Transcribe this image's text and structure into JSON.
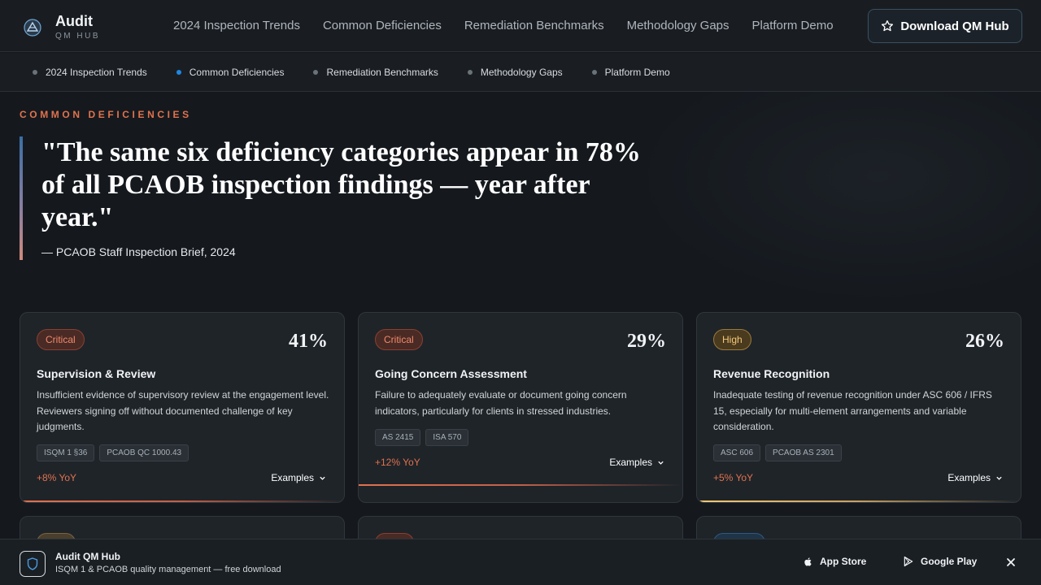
{
  "brand": {
    "name": "Audit",
    "sub": "QM HUB"
  },
  "topnav": [
    "2024 Inspection Trends",
    "Common Deficiencies",
    "Remediation Benchmarks",
    "Methodology Gaps",
    "Platform Demo"
  ],
  "download_label": "Download QM Hub",
  "subnav": {
    "active_index": 1,
    "items": [
      "2024 Inspection Trends",
      "Common Deficiencies",
      "Remediation Benchmarks",
      "Methodology Gaps",
      "Platform Demo"
    ]
  },
  "hero": {
    "eyebrow": "COMMON DEFICIENCIES",
    "quote": "\"The same six deficiency categories appear in 78% of all PCAOB inspection findings — year after year.\"",
    "source": "— PCAOB Staff Inspection Brief, 2024"
  },
  "cards": [
    {
      "severity": "Critical",
      "percent": "41%",
      "title": "Supervision & Review",
      "description": "Insufficient evidence of supervisory review at the engagement level. Reviewers signing off without documented challenge of key judgments.",
      "tags": [
        "ISQM 1 §36",
        "PCAOB QC 1000.43"
      ],
      "yoy": "+8% YoY",
      "examples": "Examples"
    },
    {
      "severity": "Critical",
      "percent": "29%",
      "title": "Going Concern Assessment",
      "description": "Failure to adequately evaluate or document going concern indicators, particularly for clients in stressed industries.",
      "tags": [
        "AS 2415",
        "ISA 570"
      ],
      "yoy": "+12% YoY",
      "examples": "Examples"
    },
    {
      "severity": "High",
      "percent": "26%",
      "title": "Revenue Recognition",
      "description": "Inadequate testing of revenue recognition under ASC 606 / IFRS 15, especially for multi-element arrangements and variable consideration.",
      "tags": [
        "ASC 606",
        "PCAOB AS 2301"
      ],
      "yoy": "+5% YoY",
      "examples": "Examples"
    }
  ],
  "appbar": {
    "name": "Audit QM Hub",
    "description": "ISQM 1 & PCAOB quality management — free download",
    "app_store": "App Store",
    "google_play": "Google Play"
  },
  "colors": {
    "accent": "#e0724e",
    "active_dot": "#1e88e5",
    "high": "#f4c876"
  }
}
